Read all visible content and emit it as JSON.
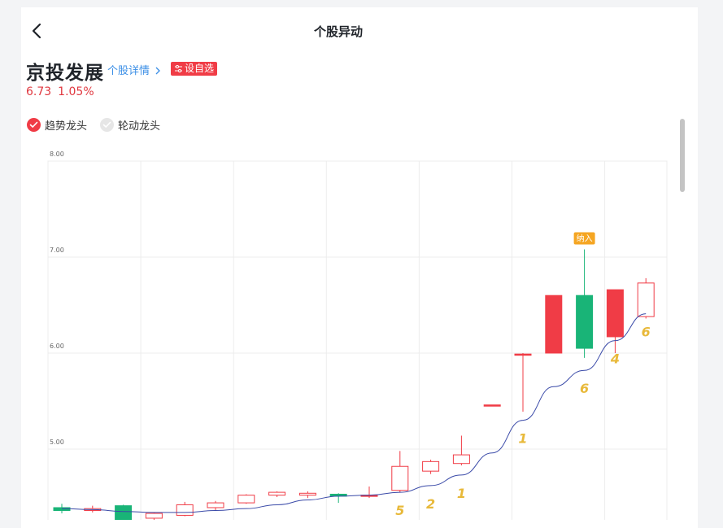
{
  "nav": {
    "title": "个股异动",
    "back_icon": "chevron-left-icon"
  },
  "stock": {
    "name": "京投发展",
    "detail_link": "个股详情",
    "fav_button": "设自选",
    "price": "6.73",
    "change_pct": "1.05%"
  },
  "options": [
    {
      "label": "趋势龙头",
      "checked": true,
      "color": "#f03c46"
    },
    {
      "label": "轮动龙头",
      "checked": false,
      "color": "#e6e6e6"
    }
  ],
  "colors": {
    "up": "#f03c46",
    "down": "#19b477",
    "ma": "#3a4aa8",
    "rank": "#e8b93a",
    "tag": "#f5a623"
  },
  "chart_data": {
    "type": "candlestick",
    "ylim": [
      4.3,
      8.1
    ],
    "y_ticks": [
      "8.00",
      "7.00",
      "6.00",
      "5.00"
    ],
    "y_tick_values": [
      8,
      7,
      6,
      5
    ],
    "candles": [
      {
        "o": 4.39,
        "c": 4.36,
        "h": 4.43,
        "l": 4.33
      },
      {
        "o": 4.36,
        "c": 4.38,
        "h": 4.41,
        "l": 4.34
      },
      {
        "o": 4.41,
        "c": 4.26,
        "h": 4.42,
        "l": 4.25
      },
      {
        "o": 4.28,
        "c": 4.33,
        "h": 4.34,
        "l": 4.26
      },
      {
        "o": 4.31,
        "c": 4.42,
        "h": 4.45,
        "l": 4.3
      },
      {
        "o": 4.39,
        "c": 4.44,
        "h": 4.46,
        "l": 4.36
      },
      {
        "o": 4.44,
        "c": 4.52,
        "h": 4.53,
        "l": 4.43
      },
      {
        "o": 4.52,
        "c": 4.55,
        "h": 4.56,
        "l": 4.5
      },
      {
        "o": 4.52,
        "c": 4.54,
        "h": 4.56,
        "l": 4.49
      },
      {
        "o": 4.53,
        "c": 4.51,
        "h": 4.54,
        "l": 4.44
      },
      {
        "o": 4.51,
        "c": 4.52,
        "h": 4.61,
        "l": 4.49
      },
      {
        "o": 4.57,
        "c": 4.82,
        "h": 4.98,
        "l": 4.55
      },
      {
        "o": 4.77,
        "c": 4.87,
        "h": 4.89,
        "l": 4.74
      },
      {
        "o": 4.85,
        "c": 4.94,
        "h": 5.14,
        "l": 4.83
      },
      {
        "o": 5.45,
        "c": 5.46,
        "h": 5.46,
        "l": 5.45
      },
      {
        "o": 5.99,
        "c": 5.99,
        "h": 6.0,
        "l": 5.39
      },
      {
        "o": 6.0,
        "c": 6.6,
        "h": 6.6,
        "l": 6.0
      },
      {
        "o": 6.6,
        "c": 6.05,
        "h": 7.08,
        "l": 5.95
      },
      {
        "o": 6.17,
        "c": 6.66,
        "h": 6.66,
        "l": 6.0
      },
      {
        "o": 6.38,
        "c": 6.73,
        "h": 6.78,
        "l": 6.36
      }
    ],
    "ma": [
      4.38,
      4.37,
      4.35,
      4.34,
      4.34,
      4.36,
      4.38,
      4.42,
      4.47,
      4.51,
      4.52,
      4.55,
      4.62,
      4.73,
      4.96,
      5.3,
      5.65,
      5.82,
      6.13,
      6.41
    ],
    "rank_labels": [
      {
        "index": 11,
        "text": "5"
      },
      {
        "index": 12,
        "text": "2"
      },
      {
        "index": 13,
        "text": "1"
      },
      {
        "index": 15,
        "text": "1"
      },
      {
        "index": 17,
        "text": "6"
      },
      {
        "index": 18,
        "text": "4"
      },
      {
        "index": 19,
        "text": "6"
      }
    ],
    "tag": {
      "index": 17,
      "text": "纳入"
    }
  }
}
